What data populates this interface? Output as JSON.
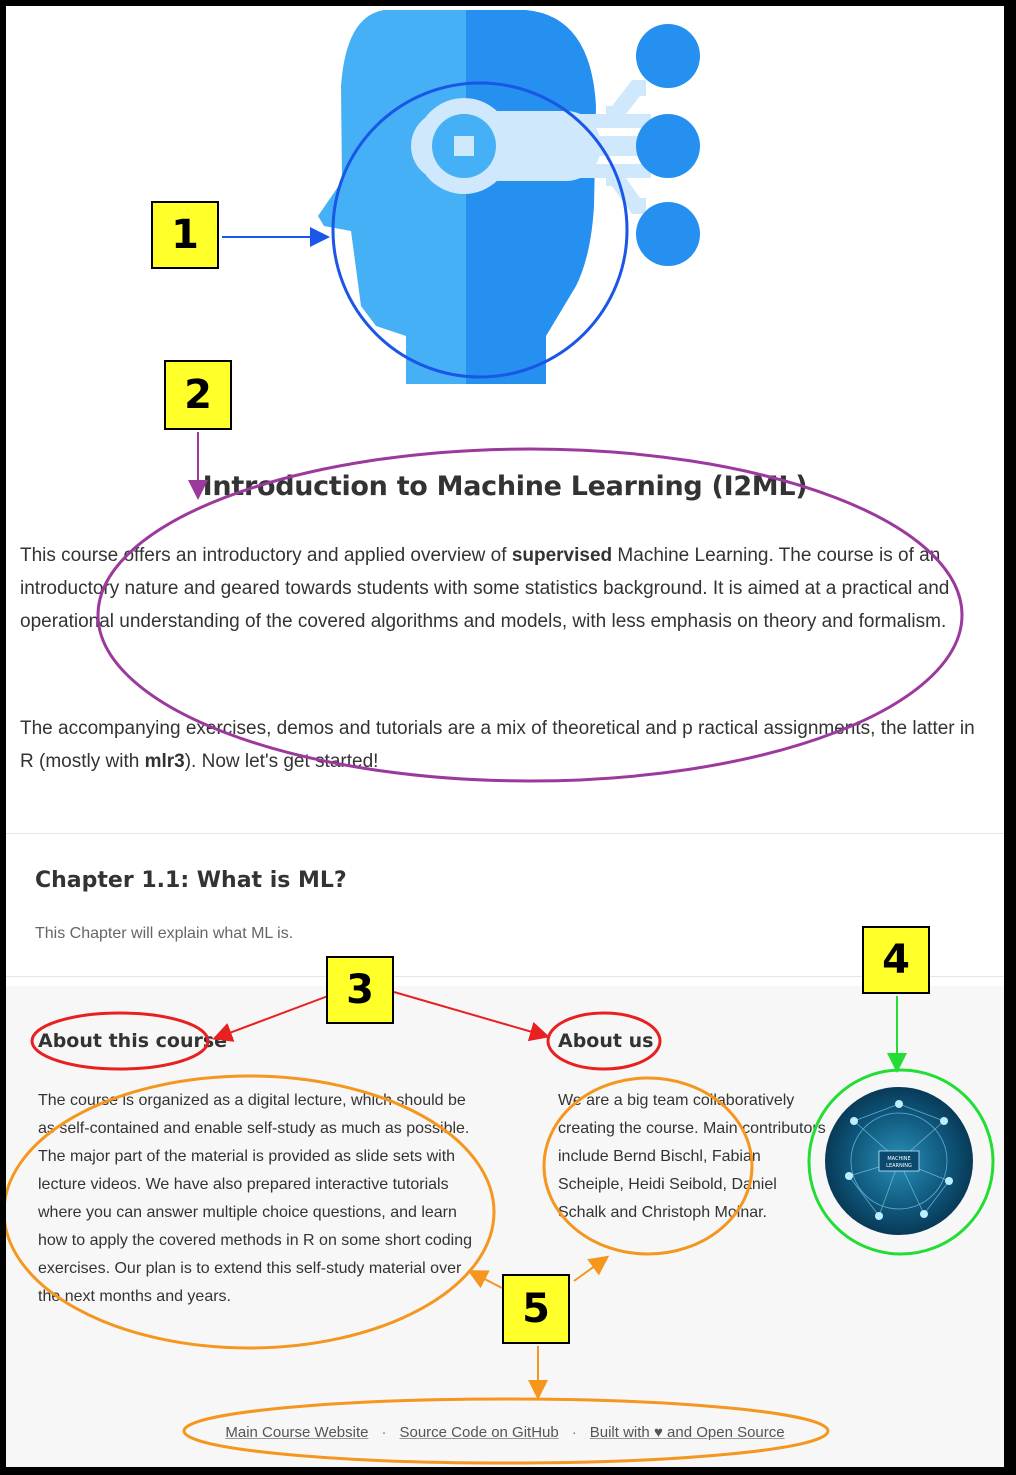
{
  "hero": {
    "title": "Introduction to Machine Learning (I2ML)",
    "icon": "ai-head-icon"
  },
  "intro": {
    "p1_a": "This course offers an introductory and applied overview of ",
    "p1_bold": "supervised",
    "p1_b": " Machine Learning. The course is of an introductory nature and geared towards students with some statistics background. It is aimed at a practical and operational understanding of the covered algorithms and models, with less emphasis on theory and formalism.",
    "p2_a": "The accompanying exercises, demos and tutorials are a mix of theoretical and p ractical assignments, the latter in R (mostly with ",
    "p2_bold": "mlr3",
    "p2_b": "). Now let's get started!"
  },
  "chapter": {
    "title": "Chapter 1.1: What is ML?",
    "description": "This Chapter will explain what ML is."
  },
  "footer": {
    "about_course": {
      "title": "About this course",
      "text": "The course is organized as a digital lecture, which should be as self-contained and enable self-study as much as possible. The major part of the material is provided as slide sets with lecture videos. We have also prepared interactive tutorials where you can answer multiple choice questions, and learn how to apply the covered methods in R on some short coding exercises. Our plan is to extend this self-study material over the next months and years."
    },
    "about_us": {
      "title": "About us",
      "text": "We are a big team collaboratively creating the course. Main contributors include Bernd Bischl, Fabian Scheiple, Heidi Seibold, Daniel Schalk and Christoph Molnar."
    },
    "badge": {
      "label": "MACHINE LEARNING"
    },
    "links": {
      "main": "Main Course Website",
      "source": "Source Code on GitHub",
      "built_prefix": "Built with ",
      "heart": "♥",
      "built_suffix": " and Open Source",
      "separator": "·"
    }
  },
  "annotations": {
    "callouts": [
      "1",
      "2",
      "3",
      "4",
      "5"
    ],
    "colors": {
      "c1": "#1a56e8",
      "c2": "#9b3a9c",
      "c3": "#e82020",
      "c4": "#22dd33",
      "c5": "#f5961e",
      "callout_bg": "#ffff2a"
    }
  }
}
